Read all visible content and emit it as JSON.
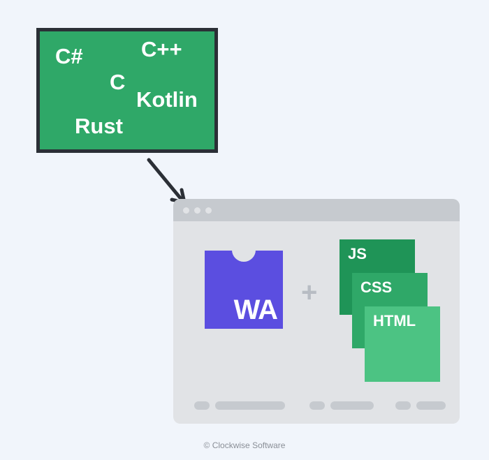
{
  "languages": {
    "csharp": "C#",
    "cpp": "C++",
    "c": "C",
    "kotlin": "Kotlin",
    "rust": "Rust"
  },
  "wa_label": "WA",
  "plus": "+",
  "tech": {
    "js": "JS",
    "css": "CSS",
    "html": "HTML"
  },
  "attribution": "© Clockwise Software"
}
